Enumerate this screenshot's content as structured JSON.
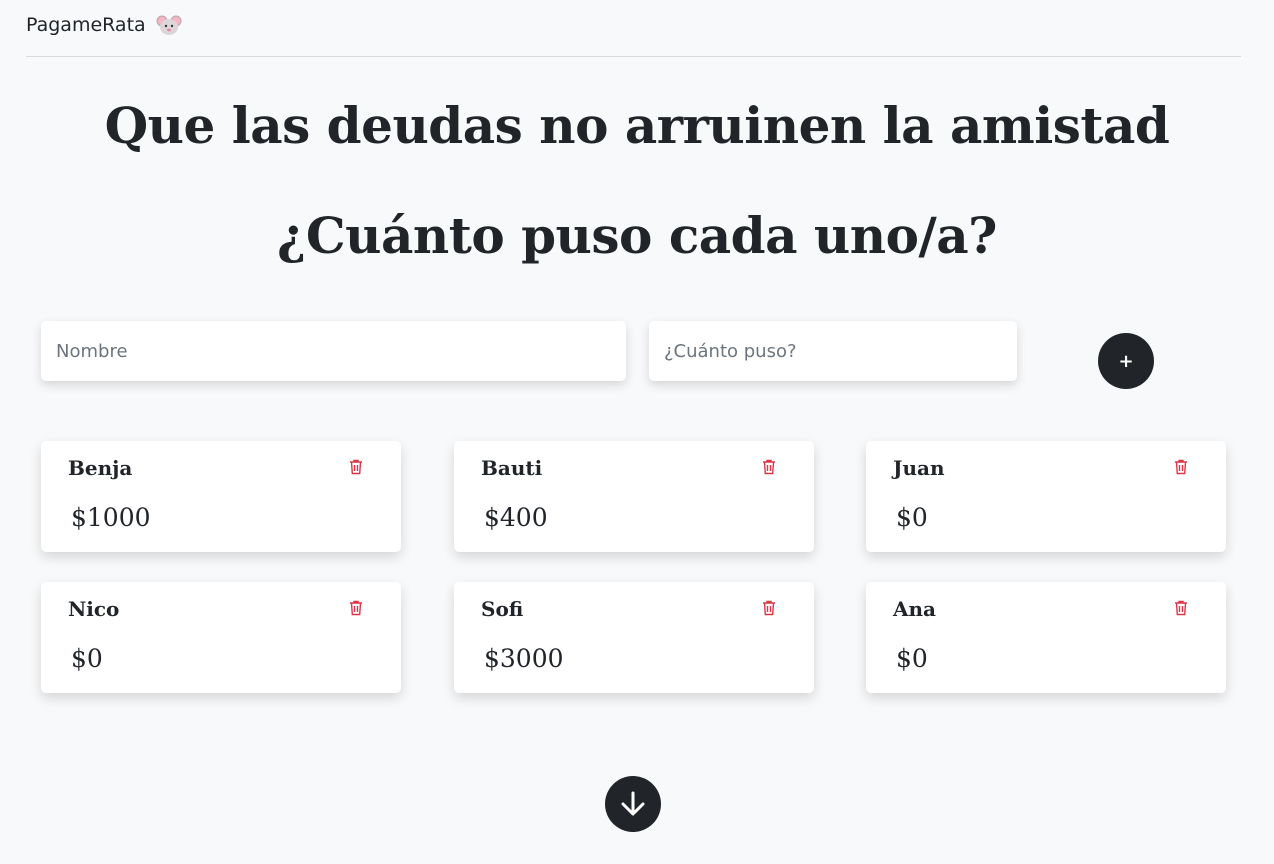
{
  "navbar": {
    "brand": "PagameRata"
  },
  "hero": {
    "title": "Que las deudas no arruinen la amistad",
    "subtitle": "¿Cuánto puso cada uno/a?"
  },
  "form": {
    "name_placeholder": "Nombre",
    "amount_placeholder": "¿Cuánto puso?",
    "name_value": "",
    "amount_value": "",
    "add_label": "+"
  },
  "people": [
    {
      "name": "Benja",
      "amount": "$1000"
    },
    {
      "name": "Bauti",
      "amount": "$400"
    },
    {
      "name": "Juan",
      "amount": "$0"
    },
    {
      "name": "Nico",
      "amount": "$0"
    },
    {
      "name": "Sofi",
      "amount": "$3000"
    },
    {
      "name": "Ana",
      "amount": "$0"
    }
  ],
  "colors": {
    "background": "#f8f9fa",
    "dark": "#212529",
    "danger": "#dc3545"
  },
  "icons": {
    "brand": "mouse-icon",
    "delete": "trash-icon",
    "scroll": "arrow-down-icon"
  }
}
